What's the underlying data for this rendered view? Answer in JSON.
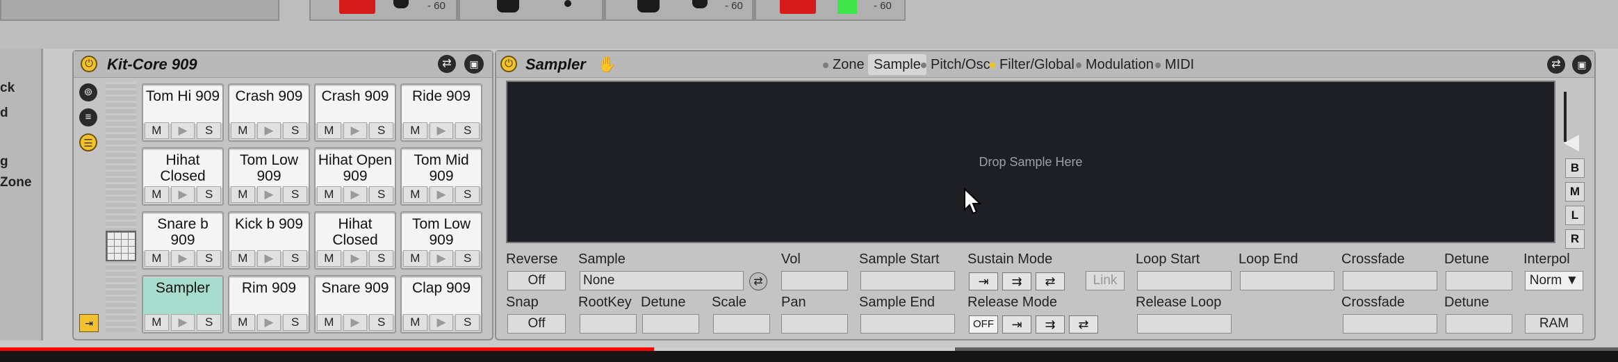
{
  "top_strip": {
    "level_values": [
      "- 60",
      "- 60",
      "- 60"
    ]
  },
  "browser": {
    "items": [
      "ck",
      "d",
      "g",
      "Zone"
    ]
  },
  "drum_rack": {
    "title": "Kit-Core 909",
    "power_icon": "power-icon",
    "pads": [
      {
        "name": "Tom Hi 909",
        "active": false
      },
      {
        "name": "Crash 909",
        "active": false
      },
      {
        "name": "Crash 909",
        "active": false
      },
      {
        "name": "Ride 909",
        "active": false
      },
      {
        "name": "Hihat Closed",
        "active": false
      },
      {
        "name": "Tom Low 909",
        "active": false
      },
      {
        "name": "Hihat Open 909",
        "active": false
      },
      {
        "name": "Tom Mid 909",
        "active": false
      },
      {
        "name": "Snare b 909",
        "active": false
      },
      {
        "name": "Kick b 909",
        "active": false
      },
      {
        "name": "Hihat Closed",
        "active": false
      },
      {
        "name": "Tom Low 909",
        "active": false
      },
      {
        "name": "Sampler",
        "active": true
      },
      {
        "name": "Rim 909",
        "active": false
      },
      {
        "name": "Snare 909",
        "active": false
      },
      {
        "name": "Clap 909",
        "active": false
      }
    ],
    "pad_buttons": {
      "mute": "M",
      "play": "▶",
      "solo": "S"
    }
  },
  "sampler": {
    "title": "Sampler",
    "tabs": [
      {
        "label": "Zone ◀",
        "selected": false,
        "dot": true,
        "dot_color": "gray"
      },
      {
        "label": "Sample",
        "selected": true,
        "dot": false,
        "dot_color": ""
      },
      {
        "label": "Pitch/Osc",
        "selected": false,
        "dot": true,
        "dot_color": "gray"
      },
      {
        "label": "Filter/Global",
        "selected": false,
        "dot": true,
        "dot_color": "yellow"
      },
      {
        "label": "Modulation",
        "selected": false,
        "dot": true,
        "dot_color": "gray"
      },
      {
        "label": "MIDI",
        "selected": false,
        "dot": true,
        "dot_color": "gray"
      }
    ],
    "drop_text": "Drop Sample Here",
    "side_buttons": [
      "B",
      "M",
      "L",
      "R"
    ],
    "labels": {
      "reverse": "Reverse",
      "sample": "Sample",
      "vol": "Vol",
      "sample_start": "Sample Start",
      "sustain_mode": "Sustain Mode",
      "loop_start": "Loop Start",
      "loop_end": "Loop End",
      "crossfade": "Crossfade",
      "detune": "Detune",
      "interpol": "Interpol",
      "snap": "Snap",
      "rootkey": "RootKey",
      "detune2": "Detune",
      "scale": "Scale",
      "pan": "Pan",
      "sample_end": "Sample End",
      "release_mode": "Release Mode",
      "release_loop": "Release Loop",
      "crossfade2": "Crossfade",
      "detune3": "Detune"
    },
    "values": {
      "reverse": "Off",
      "sample": "None",
      "snap": "Off",
      "link": "Link",
      "interpol": "Norm ▼",
      "ram": "RAM",
      "release_off": "OFF"
    }
  },
  "colors": {
    "power": "#f2c230",
    "active_pad": "#a8dccd",
    "progress": "#ff0000",
    "waveform_bg": "#1d1f24"
  },
  "video_progress": {
    "played": 0.404,
    "buffered": 0.59
  }
}
